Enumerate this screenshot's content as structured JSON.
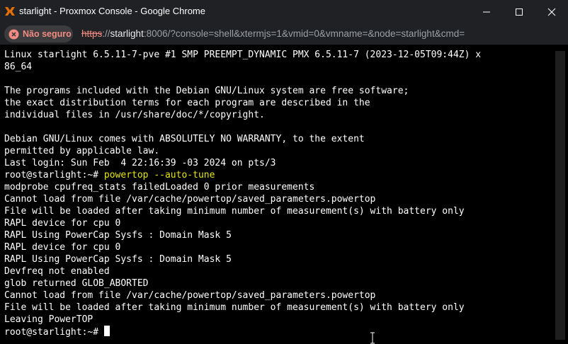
{
  "window": {
    "title": "starlight - Proxmox Console - Google Chrome"
  },
  "address": {
    "security_label": "Não seguro",
    "url_scheme": "https",
    "url_sep": "://",
    "url_host": "starlight",
    "url_rest": ":8006/?console=shell&xtermjs=1&vmid=0&vmname=&node=starlight&cmd="
  },
  "terminal": {
    "lines": [
      "Linux starlight 6.5.11-7-pve #1 SMP PREEMPT_DYNAMIC PMX 6.5.11-7 (2023-12-05T09:44Z) x",
      "86_64",
      "",
      "The programs included with the Debian GNU/Linux system are free software;",
      "the exact distribution terms for each program are described in the",
      "individual files in /usr/share/doc/*/copyright.",
      "",
      "Debian GNU/Linux comes with ABSOLUTELY NO WARRANTY, to the extent",
      "permitted by applicable law.",
      "Last login: Sun Feb  4 22:16:39 -03 2024 on pts/3"
    ],
    "prompt_1": "root@starlight:~# ",
    "command_1": "powertop --auto-tune",
    "output": [
      "modprobe cpufreq_stats failedLoaded 0 prior measurements",
      "Cannot load from file /var/cache/powertop/saved_parameters.powertop",
      "File will be loaded after taking minimum number of measurement(s) with battery only",
      "RAPL device for cpu 0",
      "RAPL Using PowerCap Sysfs : Domain Mask 5",
      "RAPL device for cpu 0",
      "RAPL Using PowerCap Sysfs : Domain Mask 5",
      "Devfreq not enabled",
      "glob returned GLOB_ABORTED",
      "Cannot load from file /var/cache/powertop/saved_parameters.powertop",
      "File will be loaded after taking minimum number of measurement(s) with battery only",
      "Leaving PowerTOP"
    ],
    "prompt_2": "root@starlight:~# "
  },
  "colors": {
    "titlebar_bg": "#202124",
    "terminal_bg": "#000000",
    "terminal_fg": "#ffffff",
    "command_fg": "#e5e510",
    "insecure_red": "#f28b82",
    "proxmox_orange": "#e57000"
  },
  "icons": {
    "app": "proxmox-x-icon",
    "security": "warning-icon",
    "minimize": "minimize-icon",
    "maximize": "maximize-icon",
    "close": "close-icon"
  }
}
